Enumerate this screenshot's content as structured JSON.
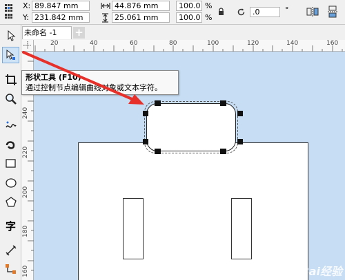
{
  "property_bar": {
    "x_label": "X:",
    "x_value": "89.847 mm",
    "y_label": "Y:",
    "y_value": "231.842 mm",
    "width_value": "44.876 mm",
    "height_value": "25.061 mm",
    "scale_w": "100.0",
    "scale_h": "100.0",
    "percent_unit": "%",
    "rotation_value": ".0",
    "degree_unit": "°"
  },
  "document_tab": {
    "title": "未命名 -1",
    "add_label": "+"
  },
  "toolbox": {
    "items": [
      "pick-tool",
      "shape-tool",
      "crop-tool",
      "zoom-tool",
      "freehand-tool",
      "artistic-media-tool",
      "rectangle-tool",
      "ellipse-tool",
      "polygon-tool",
      "text-tool",
      "dimension-tool",
      "connector-tool"
    ],
    "text_tool_glyph": "字",
    "active": "shape-tool"
  },
  "ruler": {
    "h_ticks": [
      "20",
      "40",
      "60",
      "80",
      "100",
      "120",
      "140",
      "160"
    ],
    "v_ticks": [
      "240",
      "220",
      "200",
      "180",
      "160"
    ]
  },
  "tooltip": {
    "title": "形状工具 (F10)",
    "description": "通过控制节点编辑曲线对象或文本字符。"
  },
  "watermark": "Bai经验",
  "colors": {
    "canvas_bg": "#c7ddf3",
    "arrow": "#e8302a",
    "active_tool": "#cfe3f7"
  }
}
